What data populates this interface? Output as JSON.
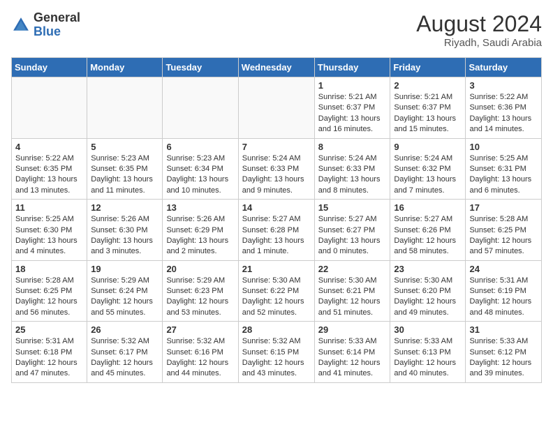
{
  "header": {
    "logo_general": "General",
    "logo_blue": "Blue",
    "month_year": "August 2024",
    "location": "Riyadh, Saudi Arabia"
  },
  "days_of_week": [
    "Sunday",
    "Monday",
    "Tuesday",
    "Wednesday",
    "Thursday",
    "Friday",
    "Saturday"
  ],
  "weeks": [
    [
      {
        "day": "",
        "info": ""
      },
      {
        "day": "",
        "info": ""
      },
      {
        "day": "",
        "info": ""
      },
      {
        "day": "",
        "info": ""
      },
      {
        "day": "1",
        "info": "Sunrise: 5:21 AM\nSunset: 6:37 PM\nDaylight: 13 hours\nand 16 minutes."
      },
      {
        "day": "2",
        "info": "Sunrise: 5:21 AM\nSunset: 6:37 PM\nDaylight: 13 hours\nand 15 minutes."
      },
      {
        "day": "3",
        "info": "Sunrise: 5:22 AM\nSunset: 6:36 PM\nDaylight: 13 hours\nand 14 minutes."
      }
    ],
    [
      {
        "day": "4",
        "info": "Sunrise: 5:22 AM\nSunset: 6:35 PM\nDaylight: 13 hours\nand 13 minutes."
      },
      {
        "day": "5",
        "info": "Sunrise: 5:23 AM\nSunset: 6:35 PM\nDaylight: 13 hours\nand 11 minutes."
      },
      {
        "day": "6",
        "info": "Sunrise: 5:23 AM\nSunset: 6:34 PM\nDaylight: 13 hours\nand 10 minutes."
      },
      {
        "day": "7",
        "info": "Sunrise: 5:24 AM\nSunset: 6:33 PM\nDaylight: 13 hours\nand 9 minutes."
      },
      {
        "day": "8",
        "info": "Sunrise: 5:24 AM\nSunset: 6:33 PM\nDaylight: 13 hours\nand 8 minutes."
      },
      {
        "day": "9",
        "info": "Sunrise: 5:24 AM\nSunset: 6:32 PM\nDaylight: 13 hours\nand 7 minutes."
      },
      {
        "day": "10",
        "info": "Sunrise: 5:25 AM\nSunset: 6:31 PM\nDaylight: 13 hours\nand 6 minutes."
      }
    ],
    [
      {
        "day": "11",
        "info": "Sunrise: 5:25 AM\nSunset: 6:30 PM\nDaylight: 13 hours\nand 4 minutes."
      },
      {
        "day": "12",
        "info": "Sunrise: 5:26 AM\nSunset: 6:30 PM\nDaylight: 13 hours\nand 3 minutes."
      },
      {
        "day": "13",
        "info": "Sunrise: 5:26 AM\nSunset: 6:29 PM\nDaylight: 13 hours\nand 2 minutes."
      },
      {
        "day": "14",
        "info": "Sunrise: 5:27 AM\nSunset: 6:28 PM\nDaylight: 13 hours\nand 1 minute."
      },
      {
        "day": "15",
        "info": "Sunrise: 5:27 AM\nSunset: 6:27 PM\nDaylight: 13 hours\nand 0 minutes."
      },
      {
        "day": "16",
        "info": "Sunrise: 5:27 AM\nSunset: 6:26 PM\nDaylight: 12 hours\nand 58 minutes."
      },
      {
        "day": "17",
        "info": "Sunrise: 5:28 AM\nSunset: 6:25 PM\nDaylight: 12 hours\nand 57 minutes."
      }
    ],
    [
      {
        "day": "18",
        "info": "Sunrise: 5:28 AM\nSunset: 6:25 PM\nDaylight: 12 hours\nand 56 minutes."
      },
      {
        "day": "19",
        "info": "Sunrise: 5:29 AM\nSunset: 6:24 PM\nDaylight: 12 hours\nand 55 minutes."
      },
      {
        "day": "20",
        "info": "Sunrise: 5:29 AM\nSunset: 6:23 PM\nDaylight: 12 hours\nand 53 minutes."
      },
      {
        "day": "21",
        "info": "Sunrise: 5:30 AM\nSunset: 6:22 PM\nDaylight: 12 hours\nand 52 minutes."
      },
      {
        "day": "22",
        "info": "Sunrise: 5:30 AM\nSunset: 6:21 PM\nDaylight: 12 hours\nand 51 minutes."
      },
      {
        "day": "23",
        "info": "Sunrise: 5:30 AM\nSunset: 6:20 PM\nDaylight: 12 hours\nand 49 minutes."
      },
      {
        "day": "24",
        "info": "Sunrise: 5:31 AM\nSunset: 6:19 PM\nDaylight: 12 hours\nand 48 minutes."
      }
    ],
    [
      {
        "day": "25",
        "info": "Sunrise: 5:31 AM\nSunset: 6:18 PM\nDaylight: 12 hours\nand 47 minutes."
      },
      {
        "day": "26",
        "info": "Sunrise: 5:32 AM\nSunset: 6:17 PM\nDaylight: 12 hours\nand 45 minutes."
      },
      {
        "day": "27",
        "info": "Sunrise: 5:32 AM\nSunset: 6:16 PM\nDaylight: 12 hours\nand 44 minutes."
      },
      {
        "day": "28",
        "info": "Sunrise: 5:32 AM\nSunset: 6:15 PM\nDaylight: 12 hours\nand 43 minutes."
      },
      {
        "day": "29",
        "info": "Sunrise: 5:33 AM\nSunset: 6:14 PM\nDaylight: 12 hours\nand 41 minutes."
      },
      {
        "day": "30",
        "info": "Sunrise: 5:33 AM\nSunset: 6:13 PM\nDaylight: 12 hours\nand 40 minutes."
      },
      {
        "day": "31",
        "info": "Sunrise: 5:33 AM\nSunset: 6:12 PM\nDaylight: 12 hours\nand 39 minutes."
      }
    ]
  ]
}
